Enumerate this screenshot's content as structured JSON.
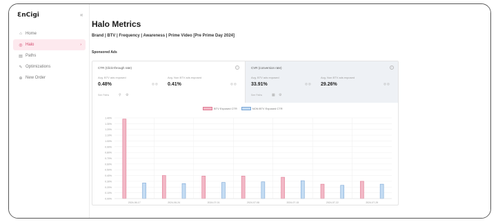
{
  "sidebar": {
    "logo": "ƐnCigi",
    "collapse_icon": "«",
    "items": [
      {
        "label": "Home",
        "icon": "home-icon",
        "glyph": "⌂",
        "active": false
      },
      {
        "label": "Halo",
        "icon": "halo-icon",
        "glyph": "◎",
        "active": true
      },
      {
        "label": "Paths",
        "icon": "paths-icon",
        "glyph": "▤",
        "active": false
      },
      {
        "label": "Optimizations",
        "icon": "optimizations-icon",
        "glyph": "✎",
        "active": false
      },
      {
        "label": "New Order",
        "icon": "new-order-icon",
        "glyph": "⊕",
        "active": false
      }
    ],
    "active_chevron": "›"
  },
  "header": {
    "title": "Halo Metrics",
    "subtitle": "Brand | BTV | Frequency | Awareness | Prime Video [Pre Prime Day 2024]"
  },
  "section_label": "Sponsored Ads",
  "panels": {
    "ctr": {
      "title": "CTR (Click-through rate)",
      "m1_label": "Avg. BTV ads exposed",
      "m1_value": "0.48%",
      "m2_label": "Avg. Non BTV ads exposed",
      "m2_value": "0.41%",
      "footer": "See Paths"
    },
    "cvr": {
      "title": "CVR (conversion rate)",
      "m1_label": "Avg. BTV ads exposed",
      "m1_value": "33.91%",
      "m2_label": "Avg. Non BTV ads exposed",
      "m2_value": "29.26%",
      "footer": "See Paths"
    }
  },
  "colors": {
    "accent": "#d2456a",
    "series_btv": "#f2b8c6",
    "series_btv_stroke": "#e07a93",
    "series_non_btv": "#c4dcf3",
    "series_non_btv_stroke": "#7aa6d6",
    "grid": "#eeeeee"
  },
  "chart_data": {
    "type": "bar",
    "series": [
      {
        "name": "BTV Exposed CTR",
        "values": [
          1.38,
          0.4,
          0.39,
          0.39,
          0.37,
          0.25,
          0.3
        ]
      },
      {
        "name": "NON BTV Exposed CTR",
        "values": [
          0.27,
          0.26,
          0.28,
          0.29,
          0.31,
          0.23,
          0.25
        ]
      }
    ],
    "categories": [
      "2024-06-17",
      "2024-06-24",
      "2024-07-01",
      "2024-07-08",
      "2024-07-15",
      "2024-07-22",
      "2024-07-29"
    ],
    "y_ticks": [
      "1.40%",
      "1.30%",
      "1.20%",
      "1.10%",
      "1.00%",
      "0.90%",
      "0.80%",
      "0.70%",
      "0.60%",
      "0.50%",
      "0.40%",
      "0.30%",
      "0.20%",
      "0.10%",
      "0.00%"
    ],
    "ylim": [
      0,
      1.4
    ],
    "legend_position": "top-center",
    "grid": true
  }
}
